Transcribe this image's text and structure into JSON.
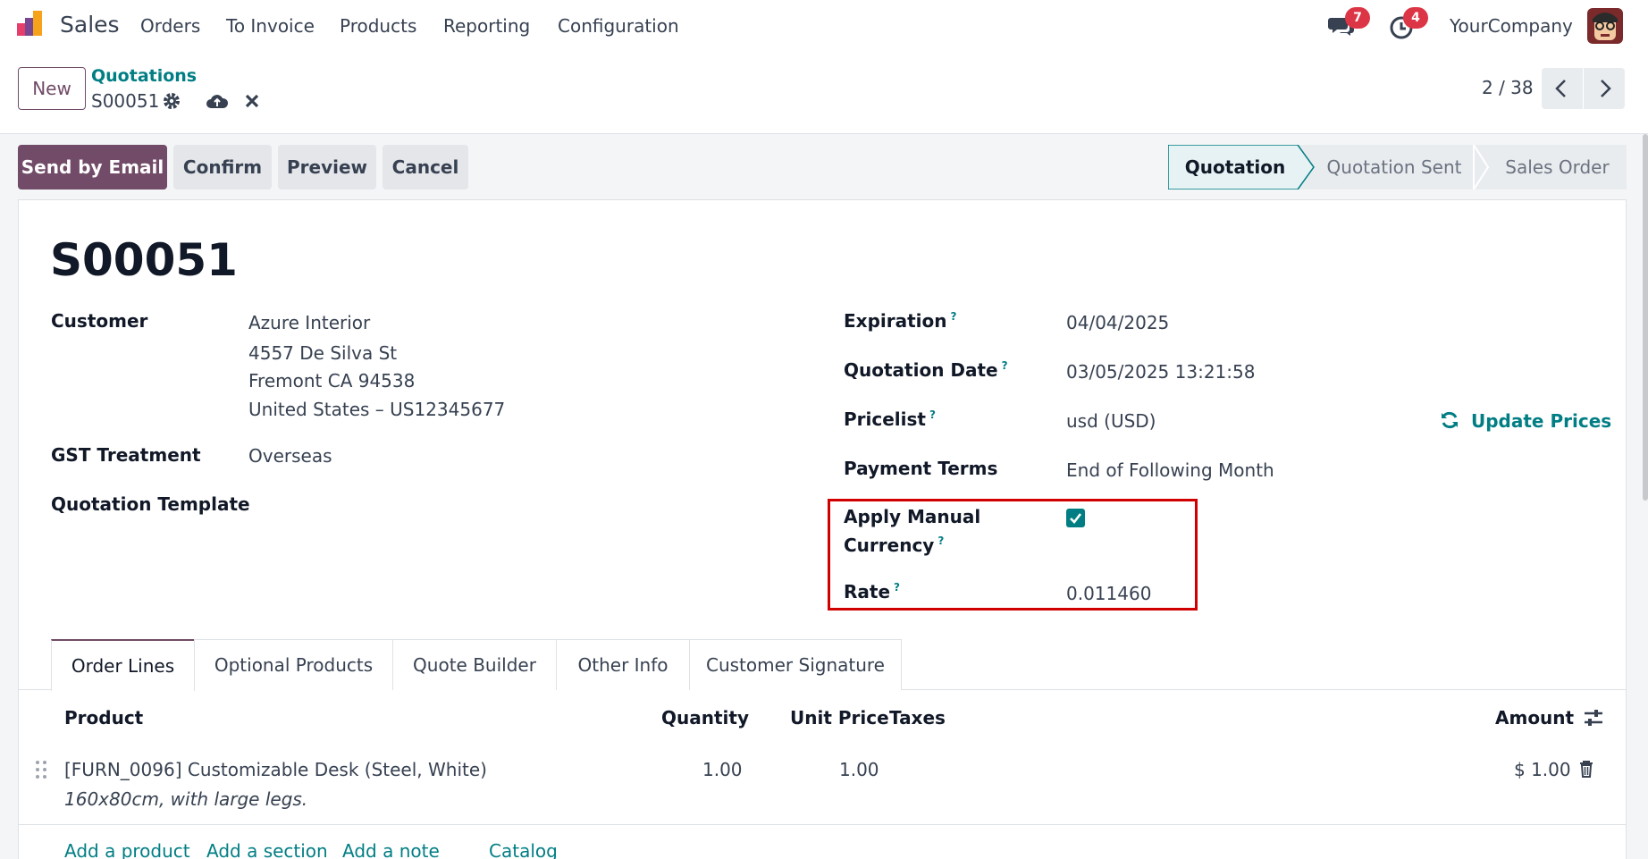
{
  "navbar": {
    "app_name": "Sales",
    "menu": [
      "Orders",
      "To Invoice",
      "Products",
      "Reporting",
      "Configuration"
    ],
    "messages_count": "7",
    "activities_count": "4",
    "company": "YourCompany"
  },
  "control": {
    "new_label": "New",
    "breadcrumb_parent": "Quotations",
    "breadcrumb_current": "S00051",
    "pager": "2 / 38"
  },
  "actions": {
    "send_email": "Send by Email",
    "confirm": "Confirm",
    "preview": "Preview",
    "cancel": "Cancel"
  },
  "status": {
    "steps": [
      "Quotation",
      "Quotation Sent",
      "Sales Order"
    ],
    "active": "Quotation"
  },
  "form": {
    "title": "S00051",
    "customer_label": "Customer",
    "customer_lines": [
      "Azure Interior",
      "4557 De Silva St",
      "Fremont CA 94538",
      "United States – US12345677"
    ],
    "gst_label": "GST Treatment",
    "gst_value": "Overseas",
    "template_label": "Quotation Template",
    "expiration_label": "Expiration",
    "expiration_value": "04/04/2025",
    "quote_date_label": "Quotation Date",
    "quote_date_value": "03/05/2025 13:21:58",
    "pricelist_label": "Pricelist",
    "pricelist_value": "usd (USD)",
    "update_prices": "Update Prices",
    "payment_terms_label": "Payment Terms",
    "payment_terms_value": "End of Following Month",
    "manual_currency_label_1": "Apply Manual",
    "manual_currency_label_2": "Currency",
    "rate_label": "Rate",
    "rate_value": "0.011460",
    "help_mark": "?"
  },
  "tabs": [
    "Order Lines",
    "Optional Products",
    "Quote Builder",
    "Other Info",
    "Customer Signature"
  ],
  "table": {
    "headers": {
      "product": "Product",
      "quantity": "Quantity",
      "unit_price": "Unit Price",
      "taxes": "Taxes",
      "amount": "Amount"
    },
    "rows": [
      {
        "product": "[FURN_0096] Customizable Desk (Steel, White)",
        "description": "160x80cm, with large legs.",
        "quantity": "1.00",
        "unit_price": "1.00",
        "amount": "$ 1.00"
      }
    ],
    "add_links": [
      "Add a product",
      "Add a section",
      "Add a note",
      "Catalog"
    ]
  },
  "colors": {
    "brand": "#714b67",
    "accent": "#017e84",
    "badge": "#dc3545",
    "highlight": "#d00000"
  }
}
